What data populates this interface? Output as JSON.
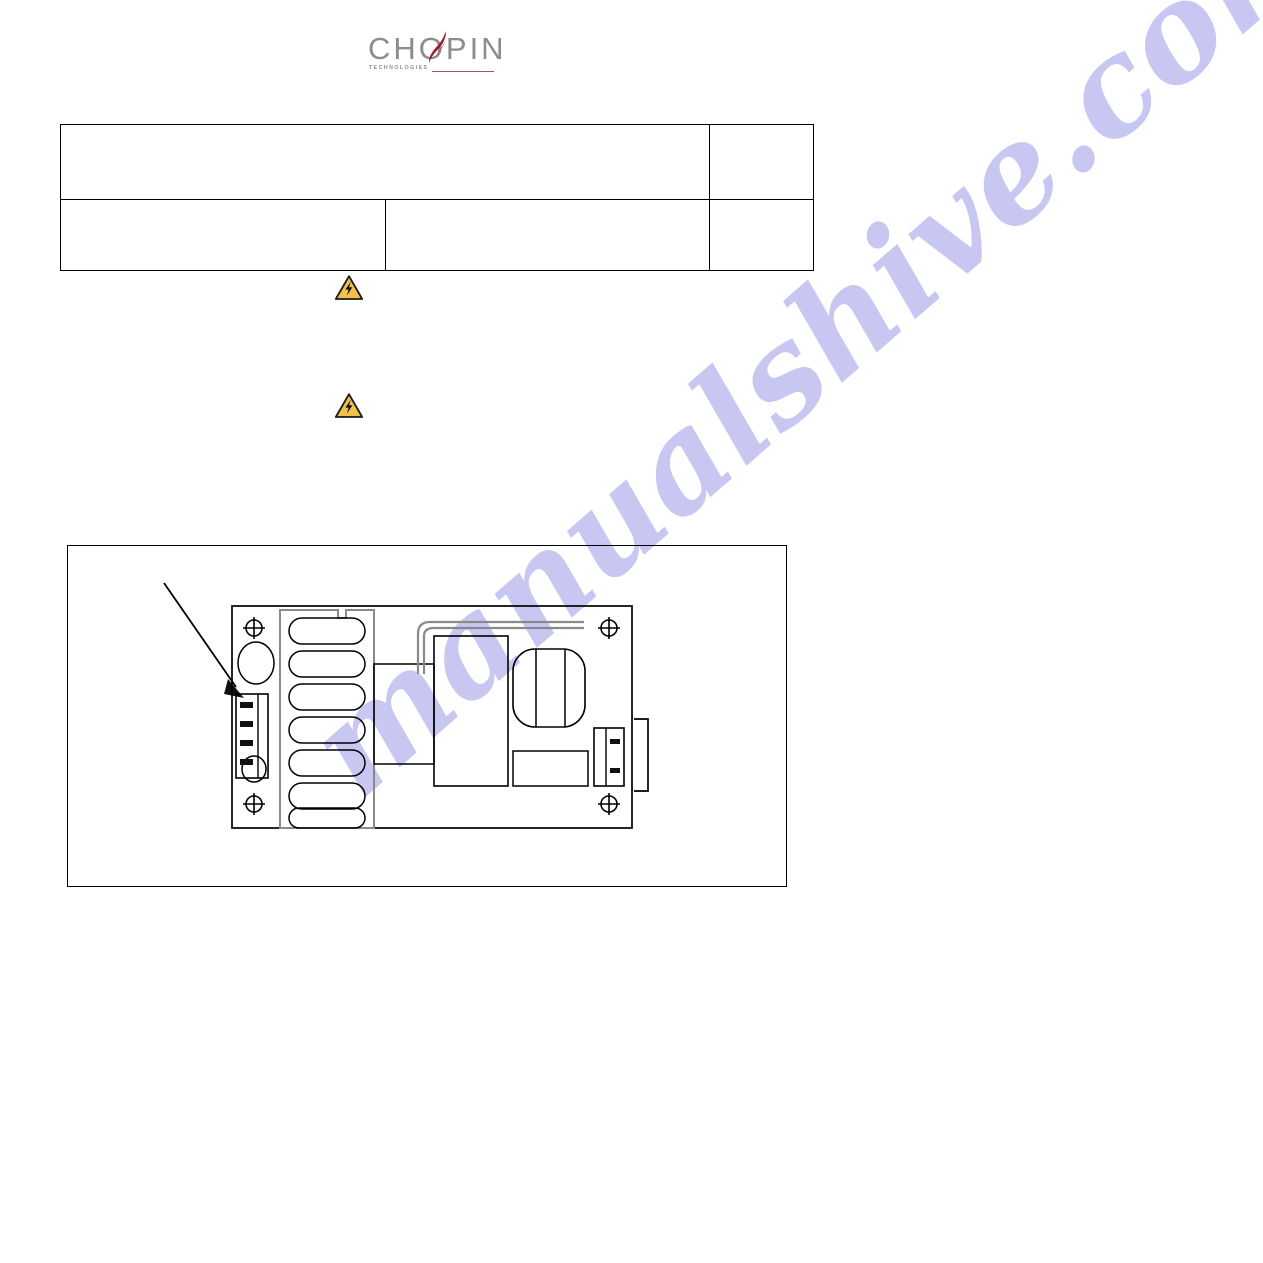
{
  "document": {
    "page_background": "#ffffff",
    "text_color": "#000000"
  },
  "logo": {
    "wordmark": "CHOPIN",
    "tagline": "TECHNOLOGIES",
    "wordmark_color": "#8c8c8c",
    "accent_color": "#9e1b32",
    "rule_color": "#a05060",
    "swoosh_icon": "flame-swoosh-icon"
  },
  "header_table": {
    "rows": [
      {
        "cells": [
          {
            "name": "title-cell",
            "text": "",
            "colspan": 2
          },
          {
            "name": "reference-cell",
            "text": "",
            "colspan": 1
          }
        ]
      },
      {
        "cells": [
          {
            "name": "section-number-cell",
            "text": "",
            "colspan": 1
          },
          {
            "name": "section-title-cell",
            "text": "",
            "colspan": 1
          },
          {
            "name": "page-number-cell",
            "text": "",
            "colspan": 1
          }
        ]
      }
    ]
  },
  "warnings": [
    {
      "name": "electrical-hazard-warning-1",
      "icon": "warning-triangle-lightning-icon",
      "text": "",
      "fill_color": "#f2c14b",
      "stroke_color": "#1a1a1a"
    },
    {
      "name": "electrical-hazard-warning-2",
      "icon": "warning-triangle-lightning-icon",
      "text": "",
      "fill_color": "#f2c14b",
      "stroke_color": "#1a1a1a"
    }
  ],
  "figure": {
    "caption": "",
    "diagram_type": "power-supply-board-schematic",
    "callout": {
      "name": "connector-callout-arrow",
      "label": "",
      "points_to": "4-pin-power-connector"
    },
    "components": [
      {
        "name": "pcb-outline",
        "label": ""
      },
      {
        "name": "heatsink-fins",
        "label": "",
        "fin_count": 7
      },
      {
        "name": "four-pin-connector",
        "label": "",
        "pin_count": 4
      },
      {
        "name": "electrolytic-capacitor",
        "label": ""
      },
      {
        "name": "small-capacitor",
        "label": ""
      },
      {
        "name": "transformer-block",
        "label": ""
      },
      {
        "name": "rounded-component",
        "label": ""
      },
      {
        "name": "terminal-block",
        "label": ""
      },
      {
        "name": "mounting-hole-top-left",
        "label": ""
      },
      {
        "name": "mounting-hole-top-right",
        "label": ""
      },
      {
        "name": "mounting-hole-bottom-left",
        "label": ""
      },
      {
        "name": "mounting-hole-bottom-right",
        "label": ""
      }
    ]
  },
  "watermark": {
    "text": "manualshive.com",
    "color": "#c7c7f2",
    "rotation_deg": -41
  }
}
